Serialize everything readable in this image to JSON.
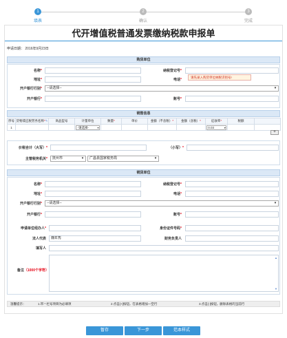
{
  "steps": [
    {
      "num": "1",
      "label": "填表"
    },
    {
      "num": "2",
      "label": "确认"
    },
    {
      "num": "3",
      "label": "完成"
    }
  ],
  "title": "代开增值税普通发票缴纳税款申报单",
  "apply_date": "申请日期：  2016年9月23日",
  "buyer": {
    "header": "购货单位",
    "name_label": "名称",
    "taxid_label": "纳税登记号",
    "address_label": "地址",
    "phone_label": "电话",
    "bank_label": "开户银行行别",
    "bank_select": "--请选择--",
    "branch_label": "开户银行",
    "account_label": "账号",
    "tip": "请先录入购货单位纳税识别号!"
  },
  "goods": {
    "header": "销售信息",
    "columns": [
      "序号",
      "货物或应税劳务名称",
      "商品型号",
      "计量单位",
      "数量",
      "单价",
      "金额（不含税）",
      "金额（含税）",
      "征收率",
      "税额"
    ],
    "row": {
      "index": "1",
      "unit_select": "-请选择-",
      "rate_select": "0.03"
    },
    "add_label": "+"
  },
  "totals": {
    "big_label": "价税合计（大写）",
    "small_label": "（小写）",
    "tax_office_label": "主管税务机关",
    "city_select": "抚州市",
    "office_select": "广昌县国家税务局"
  },
  "seller": {
    "header": "销货单位",
    "name_label": "名称",
    "taxid_label": "纳税登记号",
    "address_label": "地址",
    "phone_label": "电话",
    "bank_label": "开户银行行别",
    "bank_select": "--请选择--",
    "branch_label": "开户银行",
    "account_label": "账号",
    "agent_label": "申请单位经办人",
    "idno_label": "身份证件号码",
    "legal_label": "法人代表",
    "legal_value": "魏年秀",
    "finance_label": "财务负责人",
    "filler_label": "填写人",
    "remark_label": "备注",
    "remark_limit": "（1000个字符）"
  },
  "hints": {
    "title": "温馨提示：",
    "hint1": "1.带 * 栏号项目为必填项",
    "hint2": "2.点击[+]按钮，在表格增加一空行",
    "hint3": "3.点击[-]按钮，删除表格的当前行"
  },
  "buttons": {
    "save": "暂存",
    "next": "下一步",
    "sample": "范本样式"
  },
  "colors": {
    "accent": "#3a96d8",
    "required": "#e60012",
    "section_header": "#dbe8f6"
  }
}
